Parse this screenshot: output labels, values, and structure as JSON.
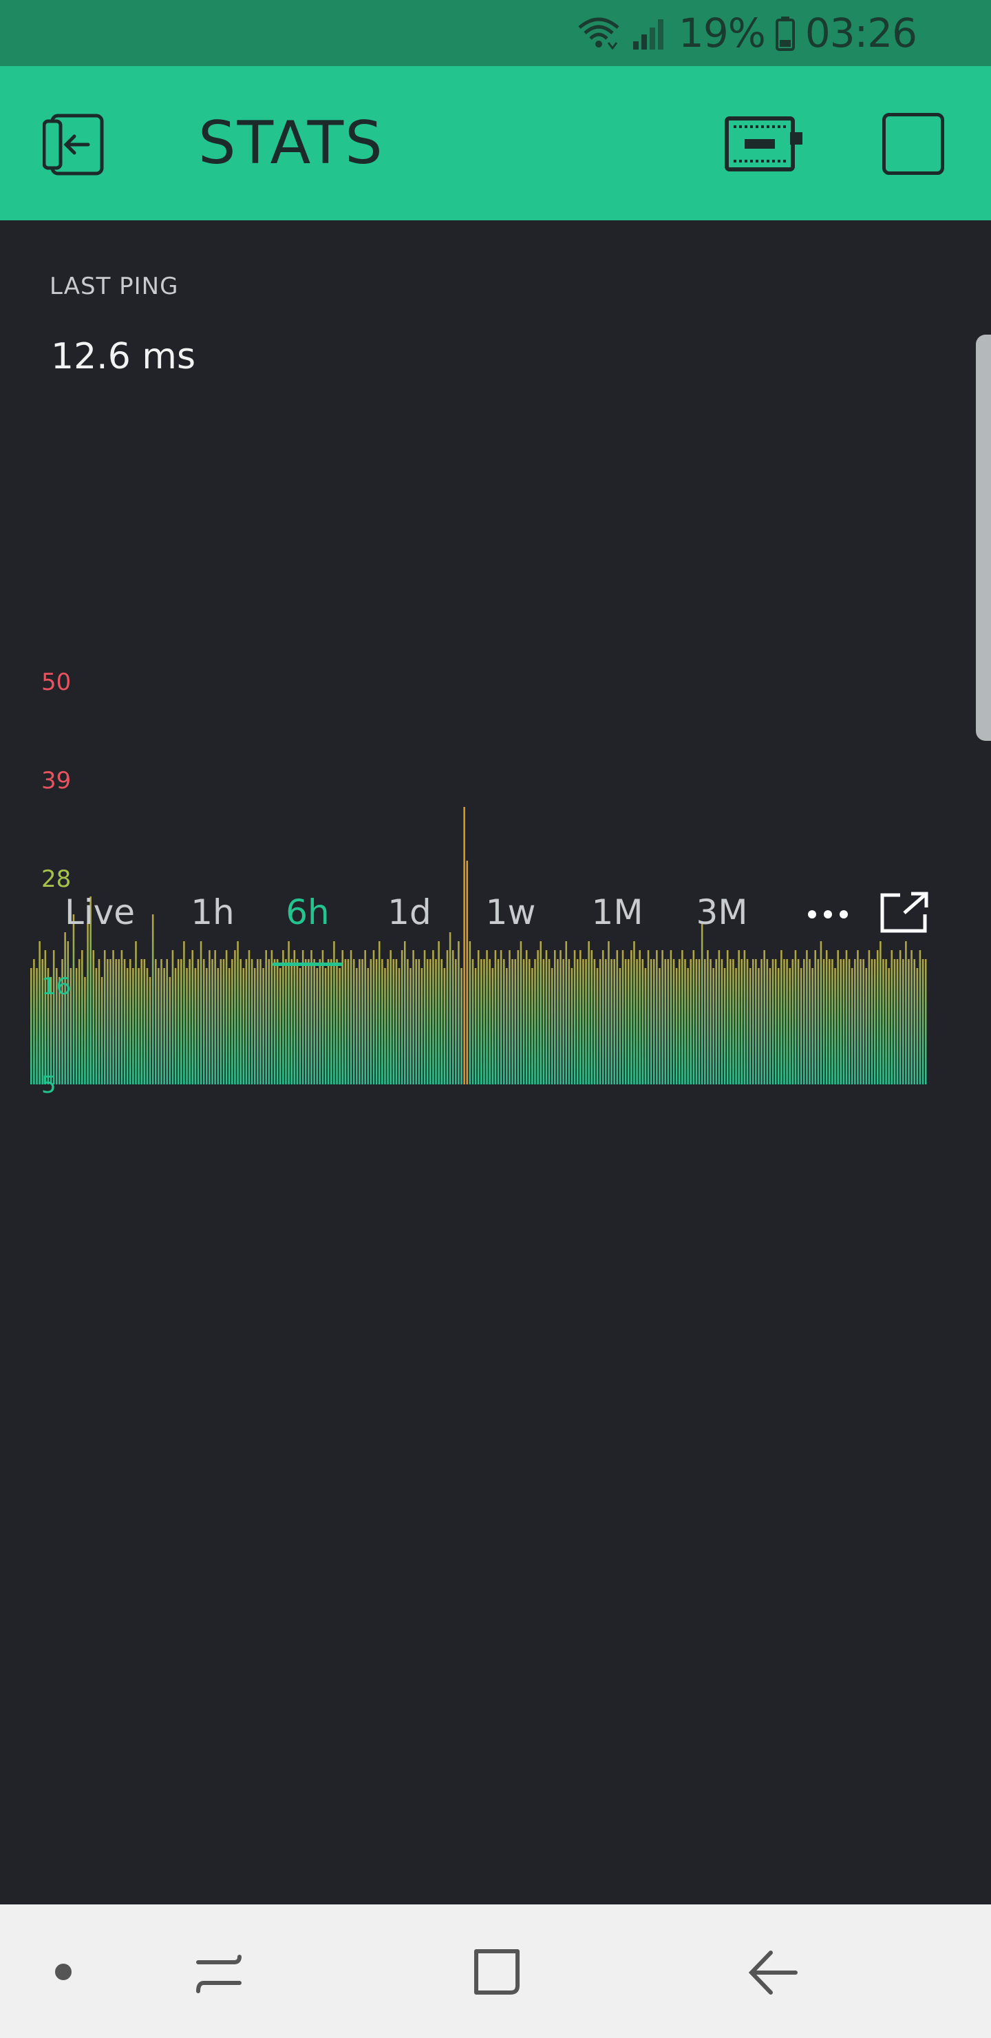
{
  "status_bar": {
    "battery_percent": "19%",
    "time": "03:26",
    "icons": [
      "wifi-icon",
      "signal-icon",
      "battery-icon"
    ]
  },
  "app_bar": {
    "title": "STATS",
    "icons": [
      "back-to-projects-icon",
      "device-icon",
      "square-icon"
    ]
  },
  "widget": {
    "label": "LAST PING",
    "value": "12.6 ms",
    "colors": {
      "accent": "#23c48e",
      "bar_top": "#b5a642",
      "spike": "#d99b2b",
      "high_tick": "#e8535f",
      "mid_tick": "#a6c24a"
    }
  },
  "time_tabs": {
    "items": [
      "Live",
      "1h",
      "6h",
      "1d",
      "1w",
      "1M",
      "3M"
    ],
    "selected": "6h",
    "more_icon": "more-dots-icon",
    "expand_icon": "expand-icon"
  },
  "chart_data": {
    "type": "bar",
    "title": "",
    "xlabel": "",
    "ylabel": "",
    "y_ticks": [
      50,
      39,
      28,
      16,
      5
    ],
    "ylim": [
      5,
      50
    ],
    "grid": false,
    "values": [
      18,
      19,
      18,
      21,
      19,
      20,
      18,
      17,
      20,
      18,
      17,
      19,
      22,
      21,
      18,
      24,
      18,
      19,
      20,
      17,
      23,
      26,
      20,
      18,
      19,
      17,
      20,
      19,
      19,
      20,
      19,
      19,
      20,
      19,
      18,
      19,
      18,
      21,
      18,
      19,
      19,
      18,
      17,
      24,
      19,
      18,
      19,
      18,
      19,
      17,
      20,
      18,
      19,
      19,
      21,
      18,
      19,
      20,
      18,
      19,
      21,
      19,
      18,
      20,
      19,
      20,
      18,
      19,
      19,
      20,
      18,
      19,
      20,
      21,
      19,
      18,
      19,
      20,
      19,
      18,
      19,
      19,
      18,
      20,
      19,
      20,
      19,
      19,
      18,
      20,
      19,
      21,
      19,
      20,
      19,
      18,
      20,
      19,
      19,
      20,
      19,
      18,
      19,
      20,
      18,
      19,
      19,
      21,
      19,
      18,
      20,
      19,
      19,
      20,
      19,
      18,
      19,
      19,
      20,
      18,
      19,
      20,
      19,
      21,
      19,
      18,
      19,
      20,
      19,
      19,
      18,
      20,
      21,
      19,
      18,
      20,
      19,
      19,
      18,
      20,
      19,
      19,
      20,
      19,
      21,
      19,
      18,
      20,
      22,
      20,
      19,
      21,
      18,
      36,
      30,
      21,
      19,
      18,
      20,
      19,
      19,
      20,
      19,
      18,
      20,
      19,
      20,
      19,
      18,
      20,
      19,
      19,
      20,
      21,
      19,
      20,
      19,
      18,
      19,
      20,
      21,
      19,
      20,
      19,
      18,
      20,
      19,
      20,
      19,
      21,
      19,
      18,
      20,
      19,
      20,
      19,
      19,
      21,
      20,
      19,
      18,
      19,
      20,
      19,
      21,
      19,
      19,
      20,
      18,
      20,
      19,
      19,
      20,
      21,
      19,
      20,
      19,
      18,
      20,
      19,
      19,
      20,
      18,
      20,
      19,
      19,
      20,
      19,
      18,
      19,
      20,
      19,
      18,
      19,
      20,
      19,
      19,
      23,
      19,
      20,
      19,
      18,
      19,
      20,
      19,
      18,
      20,
      19,
      19,
      18,
      20,
      19,
      20,
      19,
      18,
      19,
      19,
      18,
      19,
      20,
      19,
      18,
      19,
      19,
      18,
      20,
      19,
      19,
      18,
      19,
      20,
      19,
      18,
      19,
      20,
      19,
      18,
      20,
      19,
      21,
      19,
      20,
      19,
      19,
      18,
      20,
      19,
      19,
      20,
      19,
      18,
      19,
      20,
      19,
      19,
      18,
      20,
      19,
      19,
      20,
      21,
      19,
      19,
      18,
      20,
      19,
      19,
      20,
      19,
      21,
      19,
      20,
      19,
      18,
      20,
      19,
      19
    ]
  },
  "nav_bar": {
    "icons": [
      "dot-icon",
      "recent-apps-icon",
      "home-icon",
      "back-icon"
    ]
  }
}
